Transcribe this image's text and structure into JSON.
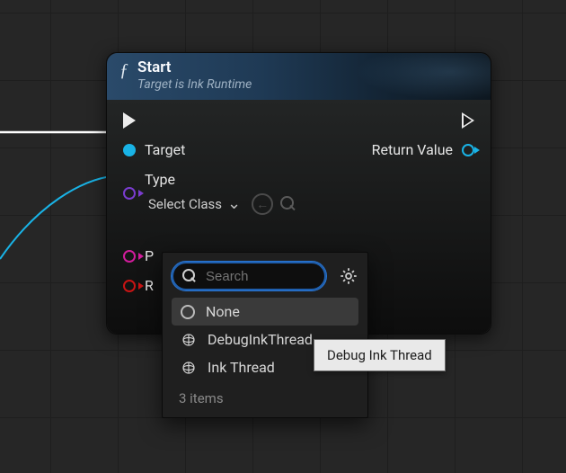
{
  "node": {
    "title": "Start",
    "subtitle": "Target is Ink Runtime",
    "pins": {
      "target": {
        "label": "Target"
      },
      "type": {
        "label": "Type",
        "selector_label": "Select Class"
      },
      "pin_p": {
        "label": "P"
      },
      "pin_r": {
        "label": "R"
      },
      "return": {
        "label": "Return Value"
      }
    }
  },
  "class_picker": {
    "search_placeholder": "Search",
    "items": [
      {
        "label": "None",
        "icon": "none"
      },
      {
        "label": "DebugInkThread",
        "icon": "object"
      },
      {
        "label": "Ink Thread",
        "icon": "object"
      }
    ],
    "selected_index": 0,
    "count_label": "3 items"
  },
  "tooltip": {
    "text": "Debug Ink Thread"
  }
}
